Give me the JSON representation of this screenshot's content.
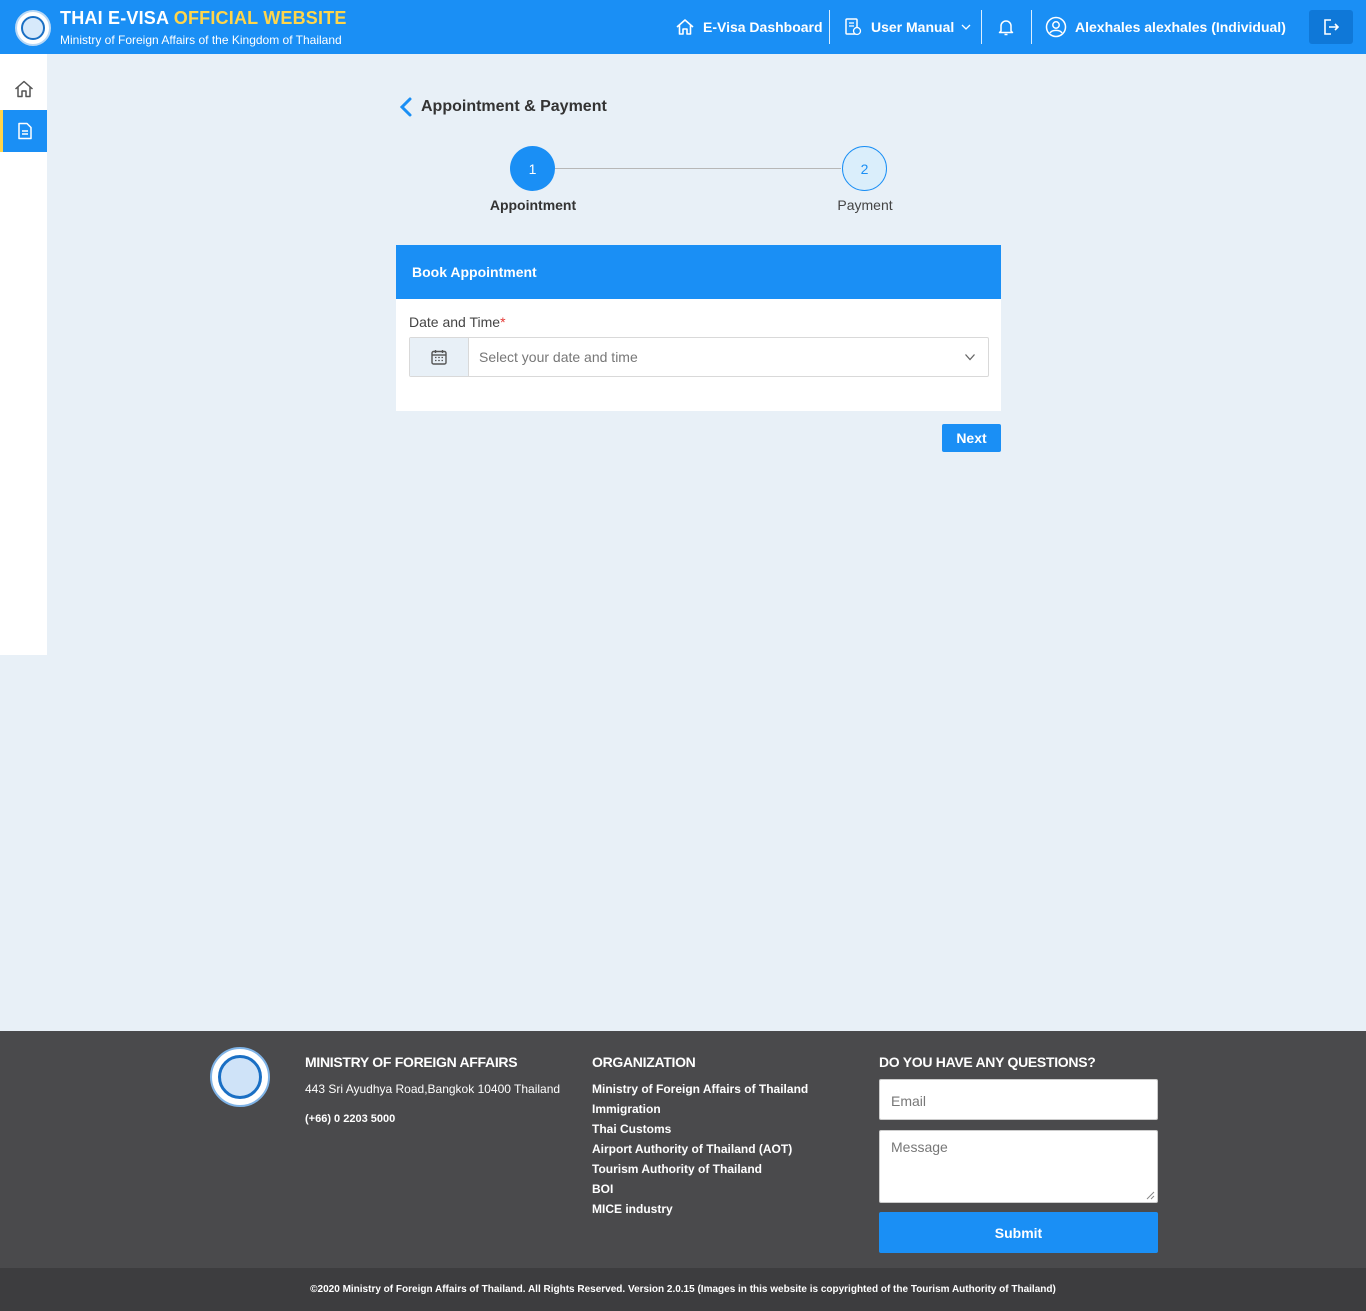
{
  "header": {
    "title_main": "THAI E-VISA ",
    "title_highlight": "OFFICIAL WEBSITE",
    "subtitle": "Ministry of Foreign Affairs of the Kingdom of Thailand",
    "nav_dashboard": "E-Visa Dashboard",
    "nav_manual": "User Manual",
    "user_name": "Alexhales alexhales (Individual)"
  },
  "sidebar": {
    "items": [
      {
        "icon": "home-icon"
      },
      {
        "icon": "document-icon",
        "active": true
      }
    ]
  },
  "page": {
    "title": "Appointment & Payment",
    "steps": [
      {
        "number": "1",
        "label": "Appointment",
        "active": true
      },
      {
        "number": "2",
        "label": "Payment",
        "active": false
      }
    ],
    "card": {
      "title": "Book Appointment",
      "field_label": "Date and Time",
      "required_mark": "*",
      "placeholder": "Select your date and time"
    },
    "next_label": "Next"
  },
  "footer": {
    "ministry_heading": "MINISTRY OF FOREIGN AFFAIRS",
    "address": "443 Sri Ayudhya Road,Bangkok 10400 Thailand",
    "phone": "(+66) 0 2203 5000",
    "org_heading": "ORGANIZATION",
    "org_links": [
      "Ministry of Foreign Affairs of Thailand",
      "Immigration",
      "Thai Customs",
      "Airport Authority of Thailand (AOT)",
      "Tourism Authority of Thailand",
      "BOI",
      "MICE industry"
    ],
    "questions_heading": "DO YOU HAVE ANY QUESTIONS?",
    "email_placeholder": "Email",
    "message_placeholder": "Message",
    "submit_label": "Submit",
    "copyright": "©2020 Ministry of Foreign Affairs of Thailand. All Rights Reserved. Version 2.0.15 (Images in this website is copyrighted of the Tourism Authority of Thailand)"
  },
  "colors": {
    "primary": "#1a8ff5",
    "highlight": "#ffd54a",
    "footer_bg": "#4a4a4c",
    "page_bg": "#e8f0f7"
  }
}
